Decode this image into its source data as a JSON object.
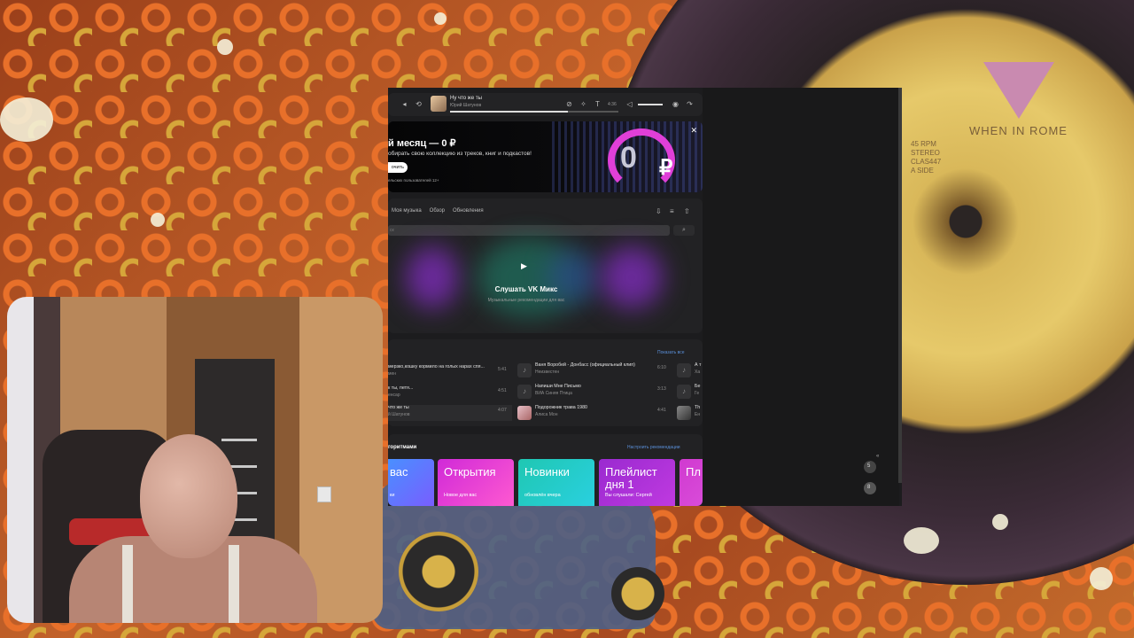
{
  "player": {
    "track_title": "Ну что же ты",
    "track_artist": "Юрий Шатунов",
    "time": "4:36"
  },
  "banner": {
    "headline": "й месяц — 0 ₽",
    "subtitle": "обирать свою коллекцию из треков, книг и подкастов!",
    "button": "очить",
    "fine_print": "ельских пользователей 12+",
    "promo_big": "0",
    "promo_currency": "₽"
  },
  "tabs": [
    "Моя музыка",
    "Обзор",
    "Обновления"
  ],
  "search": {
    "placeholder": "ск"
  },
  "mix": {
    "title": "Слушать VK Микс",
    "subtitle": "Музыкальные рекомендации для вас"
  },
  "tracks_section": {
    "show_all": "Показать все",
    "rows": [
      {
        "title": "мерзко,кошку кормило на голых нарах спя...",
        "artist": "мен",
        "duration": "5:41"
      },
      {
        "title": "к ты, петя...",
        "artist": "енсар",
        "duration": "4:51"
      },
      {
        "title": "что же ты",
        "artist": "й Шатунов",
        "duration": "4:07"
      },
      {
        "title": "Ваня Воробей - Донбасс (официальный клип)",
        "artist": "Неизвестен",
        "duration": "6:10"
      },
      {
        "title": "Напиши Мне Письмо",
        "artist": "ВИА Синяя Птица",
        "duration": "3:13"
      },
      {
        "title": "Подорожник трава 1980",
        "artist": "Алиса Мон",
        "duration": "4:41"
      },
      {
        "title": "А т",
        "artist": "Ха",
        "duration": ""
      },
      {
        "title": "Бе",
        "artist": "Ге",
        "duration": ""
      },
      {
        "title": "Тh",
        "artist": "Ен",
        "duration": ""
      }
    ]
  },
  "algorithms": {
    "heading": "горитмами",
    "configure": "Настроить рекомендации",
    "tiles": [
      {
        "title": "вас",
        "subtitle": "ки",
        "color_a": "#3aa0ff",
        "color_b": "#7a5cff"
      },
      {
        "title": "Открытия",
        "subtitle": "Новое для вас",
        "color_a": "#d02ad8",
        "color_b": "#ff5ad0"
      },
      {
        "title": "Новинки",
        "subtitle": "обновлён вчера",
        "color_a": "#1fc7b2",
        "color_b": "#2ad0e0"
      },
      {
        "title": "Плейлист дня 1",
        "subtitle": "Вы слушали: Сергей",
        "color_a": "#9a2ad0",
        "color_b": "#c03ae0"
      },
      {
        "title": "Пл дн",
        "subtitle": "",
        "color_a": "#d03ad0",
        "color_b": "#e05ae0"
      }
    ]
  },
  "record": {
    "label": "WHEN IN ROME",
    "small": "45 RPM\nSTEREO\nCLAS447\nA SIDE"
  },
  "mini_badges": [
    "5",
    "8"
  ]
}
